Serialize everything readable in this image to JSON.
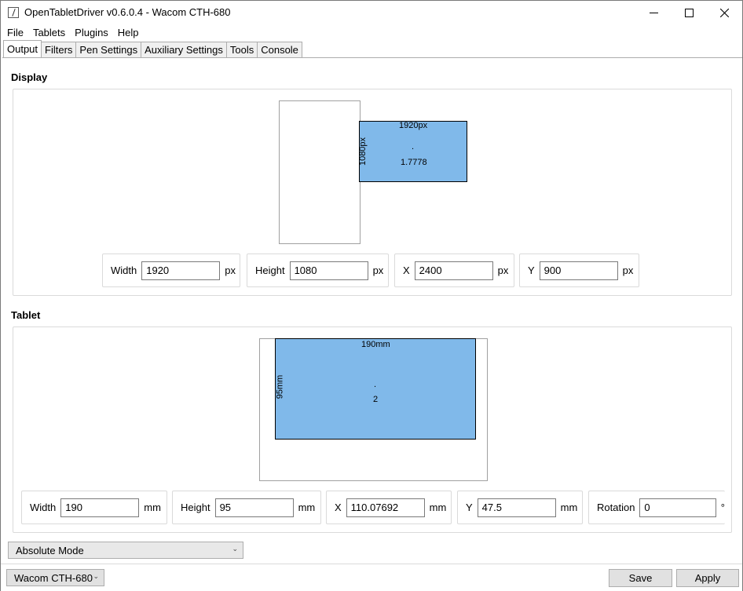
{
  "window": {
    "title": "OpenTabletDriver v0.6.0.4 - Wacom CTH-680"
  },
  "menu": [
    "File",
    "Tablets",
    "Plugins",
    "Help"
  ],
  "tabs": [
    {
      "label": "Output",
      "active": true
    },
    {
      "label": "Filters"
    },
    {
      "label": "Pen Settings"
    },
    {
      "label": "Auxiliary Settings"
    },
    {
      "label": "Tools"
    },
    {
      "label": "Console"
    }
  ],
  "display": {
    "section_title": "Display",
    "area": {
      "width_label": "1920px",
      "height_label": "1080px",
      "center_mark": ".",
      "aspect_ratio": "1.7778"
    },
    "fields": {
      "width": {
        "label": "Width",
        "value": "1920",
        "unit": "px"
      },
      "height": {
        "label": "Height",
        "value": "1080",
        "unit": "px"
      },
      "x": {
        "label": "X",
        "value": "2400",
        "unit": "px"
      },
      "y": {
        "label": "Y",
        "value": "900",
        "unit": "px"
      }
    }
  },
  "tablet": {
    "section_title": "Tablet",
    "area": {
      "width_label": "190mm",
      "height_label": "95mm",
      "center_mark": ".",
      "aspect_ratio": "2"
    },
    "fields": {
      "width": {
        "label": "Width",
        "value": "190",
        "unit": "mm"
      },
      "height": {
        "label": "Height",
        "value": "95",
        "unit": "mm"
      },
      "x": {
        "label": "X",
        "value": "110.07692",
        "unit": "mm"
      },
      "y": {
        "label": "Y",
        "value": "47.5",
        "unit": "mm"
      },
      "rotation": {
        "label": "Rotation",
        "value": "0",
        "unit": "°"
      }
    }
  },
  "output_mode": {
    "selected": "Absolute Mode"
  },
  "bottom": {
    "tablet_select": "Wacom CTH-680",
    "save_label": "Save",
    "apply_label": "Apply"
  },
  "colors": {
    "area_fill": "#80b9ea",
    "border": "#dadada"
  }
}
